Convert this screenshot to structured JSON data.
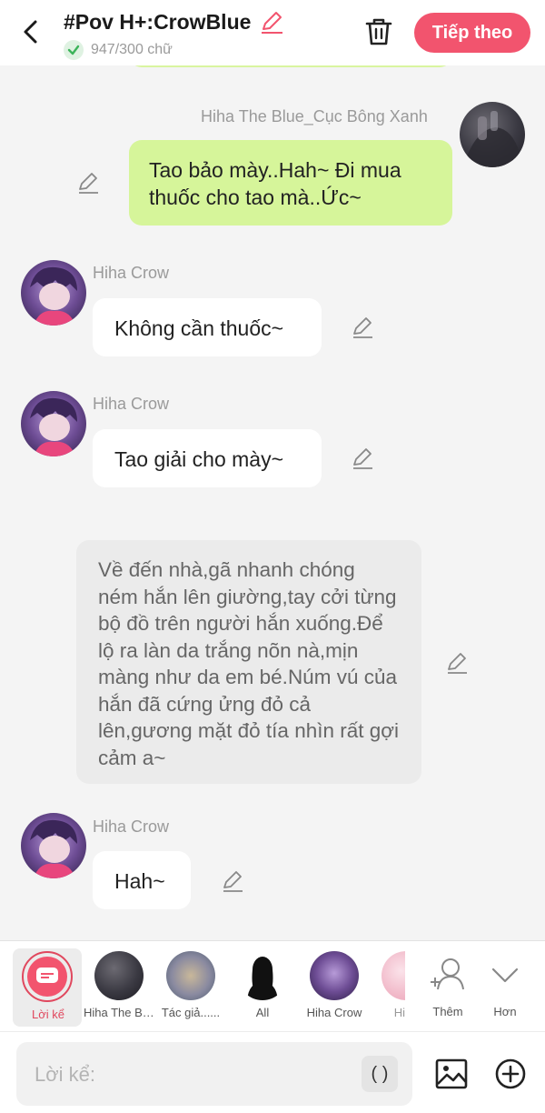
{
  "header": {
    "title": "#Pov H+:CrowBlue",
    "word_count": "947/300 chữ",
    "next_label": "Tiếp theo",
    "accent_color": "#f2546e"
  },
  "messages": [
    {
      "type": "right",
      "speaker": "Hiha The Blue_Cục Bông Xanh",
      "text": "Tao bảo mày..Hah~ Đi mua thuốc cho tao mà..Ức~"
    },
    {
      "type": "left",
      "speaker": "Hiha Crow",
      "text": "Không cần thuốc~"
    },
    {
      "type": "left",
      "speaker": "Hiha Crow",
      "text": "Tao giải cho mày~"
    },
    {
      "type": "narration",
      "text": "Về đến nhà,gã nhanh chóng ném hắn lên giường,tay cởi từng bộ đồ trên người hắn xuống.Để lộ ra làn da trắng nõn nà,mịn màng như da em bé.Núm vú của hắn đã cứng ửng đỏ cả lên,gương mặt đỏ tía nhìn rất gợi cảm a~"
    },
    {
      "type": "left",
      "speaker": "Hiha Crow",
      "text": "Hah~"
    }
  ],
  "character_bar": {
    "items": [
      {
        "label": "Lời kể",
        "selected": true
      },
      {
        "label": "Hiha The Blue_Cục Bông Xanh"
      },
      {
        "label": "Tác giả......"
      },
      {
        "label": "All"
      },
      {
        "label": "Hiha Crow"
      },
      {
        "label": "Hi"
      }
    ],
    "more_label": "Thêm",
    "collapse_label": "Hơn"
  },
  "input": {
    "placeholder": "Lời kể:",
    "paren_label": "( )"
  }
}
